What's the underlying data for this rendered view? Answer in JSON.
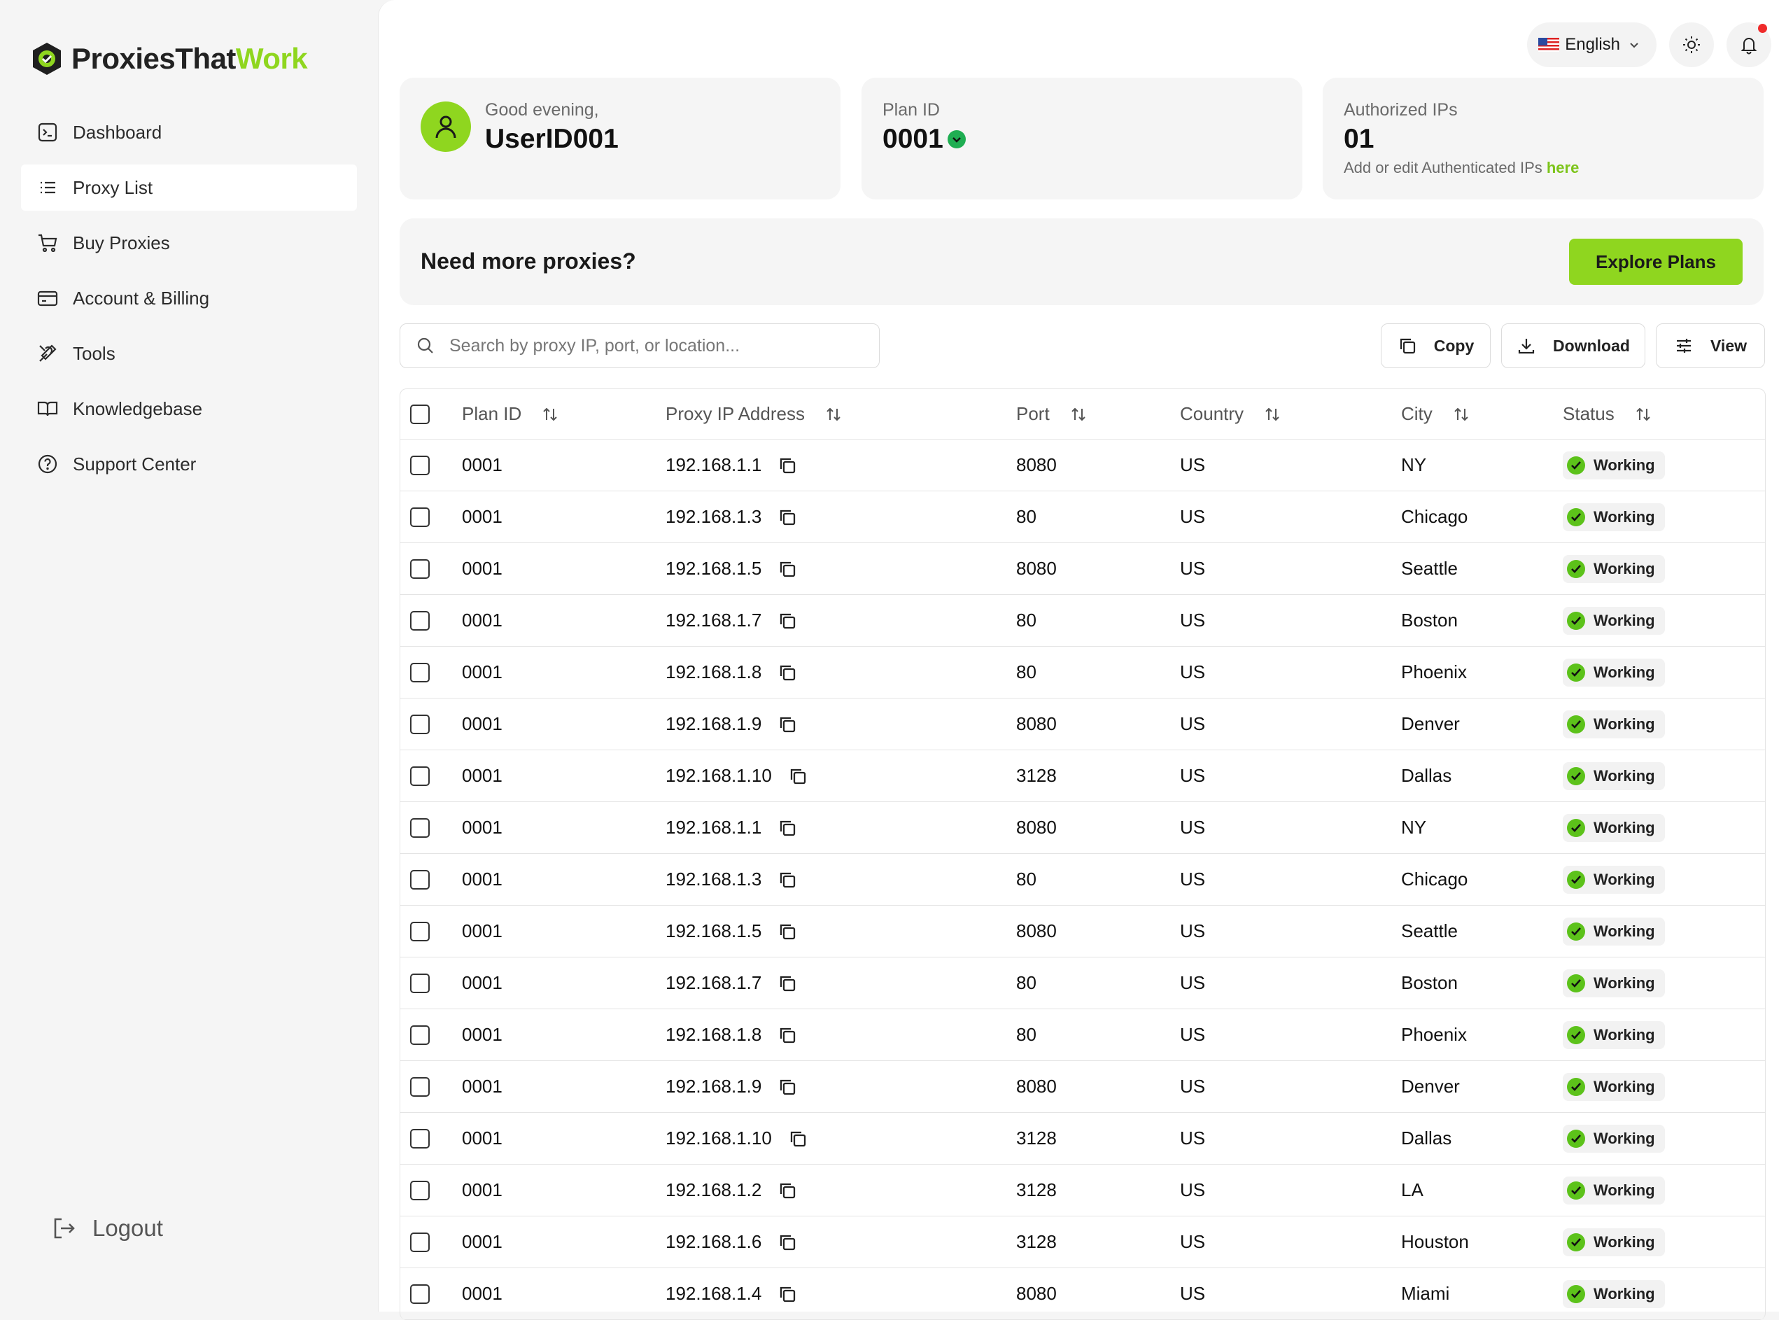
{
  "brand": {
    "part1": "ProxiesThat",
    "part2": "Work"
  },
  "nav": [
    {
      "label": "Dashboard",
      "icon": "terminal-icon"
    },
    {
      "label": "Proxy List",
      "icon": "list-icon",
      "active": true
    },
    {
      "label": "Buy Proxies",
      "icon": "cart-icon"
    },
    {
      "label": "Account & Billing",
      "icon": "credit-card-icon"
    },
    {
      "label": "Tools",
      "icon": "tools-icon"
    },
    {
      "label": "Knowledgebase",
      "icon": "book-icon"
    },
    {
      "label": "Support Center",
      "icon": "help-circle-icon"
    }
  ],
  "logout_label": "Logout",
  "topbar": {
    "language": "English"
  },
  "greeting": {
    "label": "Good evening,",
    "user": "UserID001"
  },
  "plan": {
    "label": "Plan ID",
    "value": "0001"
  },
  "authorized": {
    "label": "Authorized IPs",
    "value": "01",
    "note": "Add or edit Authenticated IPs ",
    "link": "here"
  },
  "banner": {
    "title": "Need more proxies?",
    "button": "Explore Plans"
  },
  "search": {
    "placeholder": "Search by proxy IP, port, or location..."
  },
  "toolbar": {
    "copy": "Copy",
    "download": "Download",
    "view": "View"
  },
  "table": {
    "columns": [
      "Plan ID",
      "Proxy IP Address",
      "Port",
      "Country",
      "City",
      "Status"
    ],
    "rows": [
      {
        "plan": "0001",
        "ip": "192.168.1.1",
        "port": "8080",
        "country": "US",
        "city": "NY",
        "status": "Working"
      },
      {
        "plan": "0001",
        "ip": "192.168.1.3",
        "port": "80",
        "country": "US",
        "city": "Chicago",
        "status": "Working"
      },
      {
        "plan": "0001",
        "ip": "192.168.1.5",
        "port": "8080",
        "country": "US",
        "city": "Seattle",
        "status": "Working"
      },
      {
        "plan": "0001",
        "ip": "192.168.1.7",
        "port": "80",
        "country": "US",
        "city": "Boston",
        "status": "Working"
      },
      {
        "plan": "0001",
        "ip": "192.168.1.8",
        "port": "80",
        "country": "US",
        "city": "Phoenix",
        "status": "Working"
      },
      {
        "plan": "0001",
        "ip": "192.168.1.9",
        "port": "8080",
        "country": "US",
        "city": "Denver",
        "status": "Working"
      },
      {
        "plan": "0001",
        "ip": "192.168.1.10",
        "port": "3128",
        "country": "US",
        "city": "Dallas",
        "status": "Working"
      },
      {
        "plan": "0001",
        "ip": "192.168.1.1",
        "port": "8080",
        "country": "US",
        "city": "NY",
        "status": "Working"
      },
      {
        "plan": "0001",
        "ip": "192.168.1.3",
        "port": "80",
        "country": "US",
        "city": "Chicago",
        "status": "Working"
      },
      {
        "plan": "0001",
        "ip": "192.168.1.5",
        "port": "8080",
        "country": "US",
        "city": "Seattle",
        "status": "Working"
      },
      {
        "plan": "0001",
        "ip": "192.168.1.7",
        "port": "80",
        "country": "US",
        "city": "Boston",
        "status": "Working"
      },
      {
        "plan": "0001",
        "ip": "192.168.1.8",
        "port": "80",
        "country": "US",
        "city": "Phoenix",
        "status": "Working"
      },
      {
        "plan": "0001",
        "ip": "192.168.1.9",
        "port": "8080",
        "country": "US",
        "city": "Denver",
        "status": "Working"
      },
      {
        "plan": "0001",
        "ip": "192.168.1.10",
        "port": "3128",
        "country": "US",
        "city": "Dallas",
        "status": "Working"
      },
      {
        "plan": "0001",
        "ip": "192.168.1.2",
        "port": "3128",
        "country": "US",
        "city": "LA",
        "status": "Working"
      },
      {
        "plan": "0001",
        "ip": "192.168.1.6",
        "port": "3128",
        "country": "US",
        "city": "Houston",
        "status": "Working"
      },
      {
        "plan": "0001",
        "ip": "192.168.1.4",
        "port": "8080",
        "country": "US",
        "city": "Miami",
        "status": "Working"
      }
    ]
  },
  "colors": {
    "accent": "#8fd61f",
    "status_ok": "#5cc21a",
    "notification": "#ef2b2b"
  }
}
